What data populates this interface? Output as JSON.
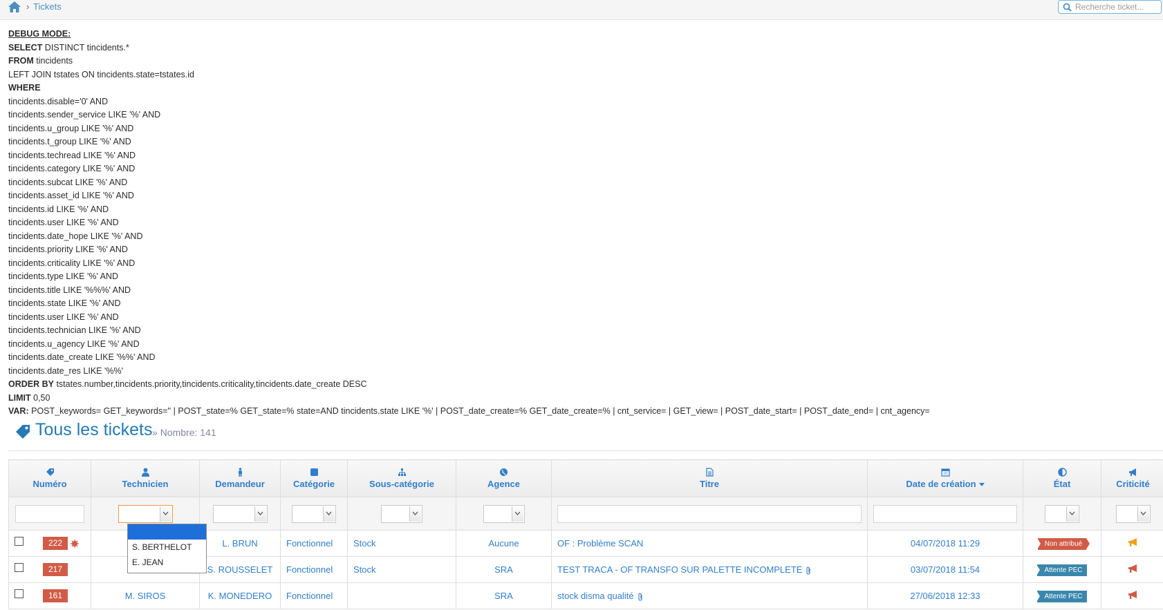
{
  "breadcrumb": {
    "separator": "›",
    "current": "Tickets",
    "home_icon": "home-icon"
  },
  "search": {
    "placeholder": "Recherche ticket..."
  },
  "debug": {
    "title": "DEBUG MODE:",
    "lines": [
      {
        "kw": "SELECT",
        "text": " DISTINCT tincidents.*"
      },
      {
        "kw": "FROM",
        "text": " tincidents"
      },
      {
        "kw": "",
        "text": "LEFT JOIN tstates ON tincidents.state=tstates.id"
      },
      {
        "kw": "WHERE",
        "text": ""
      },
      {
        "kw": "",
        "text": "tincidents.disable='0' AND"
      },
      {
        "kw": "",
        "text": "tincidents.sender_service LIKE '%' AND"
      },
      {
        "kw": "",
        "text": "tincidents.u_group LIKE '%' AND"
      },
      {
        "kw": "",
        "text": "tincidents.t_group LIKE '%' AND"
      },
      {
        "kw": "",
        "text": "tincidents.techread LIKE '%' AND"
      },
      {
        "kw": "",
        "text": "tincidents.category LIKE '%' AND"
      },
      {
        "kw": "",
        "text": "tincidents.subcat LIKE '%' AND"
      },
      {
        "kw": "",
        "text": "tincidents.asset_id LIKE '%' AND"
      },
      {
        "kw": "",
        "text": "tincidents.id LIKE '%' AND"
      },
      {
        "kw": "",
        "text": "tincidents.user LIKE '%' AND"
      },
      {
        "kw": "",
        "text": "tincidents.date_hope LIKE '%' AND"
      },
      {
        "kw": "",
        "text": "tincidents.priority LIKE '%' AND"
      },
      {
        "kw": "",
        "text": "tincidents.criticality LIKE '%' AND"
      },
      {
        "kw": "",
        "text": "tincidents.type LIKE '%' AND"
      },
      {
        "kw": "",
        "text": "tincidents.title LIKE '%%%' AND"
      },
      {
        "kw": "",
        "text": "tincidents.state LIKE '%' AND"
      },
      {
        "kw": "",
        "text": "tincidents.user LIKE '%' AND"
      },
      {
        "kw": "",
        "text": "tincidents.technician LIKE '%' AND"
      },
      {
        "kw": "",
        "text": "tincidents.u_agency LIKE '%' AND"
      },
      {
        "kw": "",
        "text": "tincidents.date_create LIKE '%%' AND"
      },
      {
        "kw": "",
        "text": "tincidents.date_res LIKE '%%'"
      },
      {
        "kw": "ORDER BY",
        "text": " tstates.number,tincidents.priority,tincidents.criticality,tincidents.date_create DESC"
      },
      {
        "kw": "LIMIT",
        "text": " 0,50"
      },
      {
        "kw": "VAR:",
        "text": " POST_keywords= GET_keywords='' | POST_state=% GET_state=% state=AND tincidents.state LIKE '%' | POST_date_create=% GET_date_create=% | cnt_service= | GET_view= | POST_date_start= | POST_date_end= | cnt_agency="
      }
    ]
  },
  "page": {
    "title": "Tous les tickets",
    "sep": "»",
    "count_label": "Nombre: 141"
  },
  "table": {
    "headers": [
      {
        "label": "Numéro",
        "icon": "tag-icon"
      },
      {
        "label": "Technicien",
        "icon": "user-icon"
      },
      {
        "label": "Demandeur",
        "icon": "male-icon"
      },
      {
        "label": "Catégorie",
        "icon": "square-icon"
      },
      {
        "label": "Sous-catégorie",
        "icon": "sitemap-icon"
      },
      {
        "label": "Agence",
        "icon": "globe-icon"
      },
      {
        "label": "Titre",
        "icon": "file-icon"
      },
      {
        "label": "Date de création",
        "icon": "calendar-icon"
      },
      {
        "label": "État",
        "icon": "adjust-icon"
      },
      {
        "label": "Criticité",
        "icon": "bullhorn-icon"
      }
    ],
    "rows": [
      {
        "num": "222",
        "tech": "",
        "demandeur": "L. BRUN",
        "categorie": "Fonctionnel",
        "souscat": "Stock",
        "agence": "Aucune",
        "titre": "OF : Problème SCAN",
        "date": "04/07/2018 11:29",
        "etat": "Non attribué",
        "etat_type": "na",
        "crit_color": "#f0a020",
        "new_flag": true,
        "attach": false
      },
      {
        "num": "217",
        "tech": "",
        "demandeur": "S. ROUSSELET",
        "categorie": "Fonctionnel",
        "souscat": "Stock",
        "agence": "SRA",
        "titre": "TEST TRACA - OF TRANSFO SUR PALETTE INCOMPLETE",
        "date": "03/07/2018 11:54",
        "etat": "Attente PEC",
        "etat_type": "at",
        "crit_color": "#d15b47",
        "new_flag": false,
        "attach": true
      },
      {
        "num": "161",
        "tech": "M. SIROS",
        "demandeur": "K. MONEDERO",
        "categorie": "Fonctionnel",
        "souscat": "",
        "agence": "SRA",
        "titre": "stock disma qualité",
        "date": "27/06/2018 12:33",
        "etat": "Attente PEC",
        "etat_type": "at",
        "crit_color": "#d15b47",
        "new_flag": false,
        "attach": true
      }
    ]
  },
  "technician_dropdown": {
    "options": [
      "",
      "S. BERTHELOT",
      "E. JEAN"
    ],
    "highlighted_index": 0
  },
  "colors": {
    "accent": "#307ecc",
    "title": "#2679b5",
    "danger": "#d15b47",
    "info": "#3a87ad",
    "warning": "#f0a020"
  }
}
